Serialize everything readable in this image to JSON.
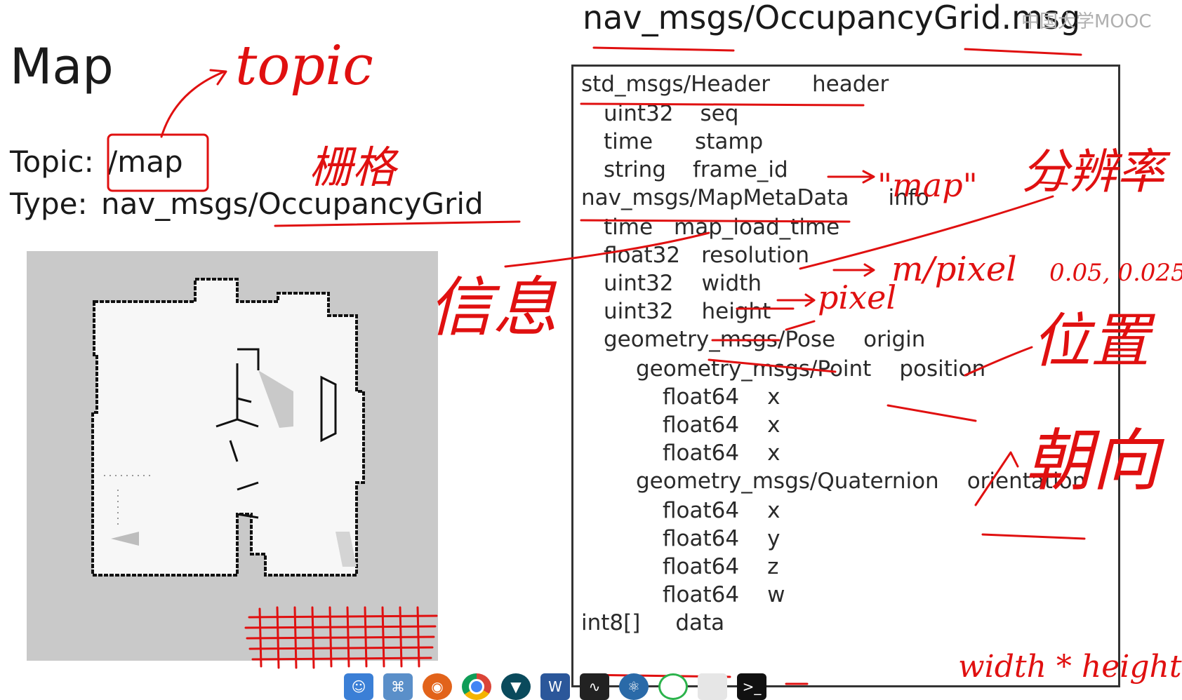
{
  "slide": {
    "title": "Map",
    "topic_label": "Topic:",
    "topic_value": "/map",
    "type_label": "Type:",
    "type_value": "nav_msgs/OccupancyGrid"
  },
  "msg": {
    "filename": "nav_msgs/OccupancyGrid.msg",
    "watermark": "中国大学MOOC",
    "lines": [
      {
        "type": "std_msgs/Header",
        "name": "header"
      },
      {
        "type": "uint32",
        "name": "seq"
      },
      {
        "type": "time",
        "name": "stamp"
      },
      {
        "type": "string",
        "name": "frame_id"
      },
      {
        "type": "nav_msgs/MapMetaData",
        "name": "info"
      },
      {
        "type": "time",
        "name": "map_load_time"
      },
      {
        "type": "float32",
        "name": "resolution"
      },
      {
        "type": "uint32",
        "name": "width"
      },
      {
        "type": "uint32",
        "name": "height"
      },
      {
        "type": "geometry_msgs/Pose",
        "name": "origin"
      },
      {
        "type": "geometry_msgs/Point",
        "name": "position"
      },
      {
        "type": "float64",
        "name": "x"
      },
      {
        "type": "float64",
        "name": "x"
      },
      {
        "type": "float64",
        "name": "x"
      },
      {
        "type": "geometry_msgs/Quaternion",
        "name": "orientation"
      },
      {
        "type": "float64",
        "name": "x"
      },
      {
        "type": "float64",
        "name": "y"
      },
      {
        "type": "float64",
        "name": "z"
      },
      {
        "type": "float64",
        "name": "w"
      },
      {
        "type": "int8[]",
        "name": "data"
      }
    ]
  },
  "annotations": {
    "topic": "topic",
    "grid": "栅格",
    "info": "信息",
    "map_quote": "\"map\"",
    "resolution": "分辨率",
    "m_per_pixel": "m/pixel",
    "resolution_values": "0.05, 0.025",
    "pixel": "pixel",
    "position": "位置",
    "orientation": "朝向",
    "data_size": "width * height"
  },
  "taskbar": {
    "icons": [
      "finder-icon",
      "network-icon",
      "firefox-icon",
      "chrome-icon",
      "torch-icon",
      "word-icon",
      "monitor-icon",
      "atom-icon",
      "spinner-icon",
      "trash-icon",
      "terminal-icon"
    ],
    "terminal_label": ">_",
    "word_label": "W"
  },
  "colors": {
    "annotation_red": "#e01010",
    "map_background": "#c9c9c9",
    "text": "#1a1a1a"
  }
}
